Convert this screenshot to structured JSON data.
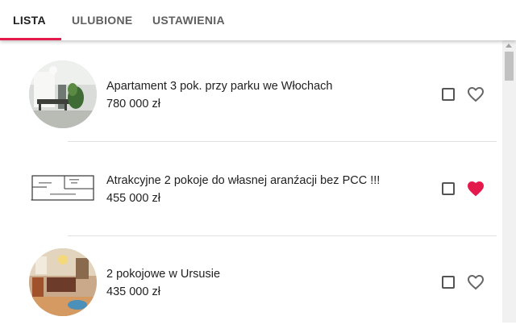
{
  "tabs": [
    {
      "label": "LISTA",
      "active": true
    },
    {
      "label": "ULUBIONE",
      "active": false
    },
    {
      "label": "USTAWIENIA",
      "active": false
    }
  ],
  "accent_color": "#e51a4c",
  "listings": [
    {
      "title": "Apartament 3 pok. przy parku we Włochach",
      "price": "780 000 zł",
      "checked": false,
      "favorite": false,
      "thumbnail": "apartment-interior-photo"
    },
    {
      "title": "Atrakcyjne 2 pokoje do własnej aranźacji bez PCC !!!",
      "price": "455 000 zł",
      "checked": false,
      "favorite": true,
      "thumbnail": "floor-plan-image"
    },
    {
      "title": "2 pokojowe w Ursusie",
      "price": "435 000 zł",
      "checked": false,
      "favorite": false,
      "thumbnail": "living-room-photo"
    }
  ]
}
